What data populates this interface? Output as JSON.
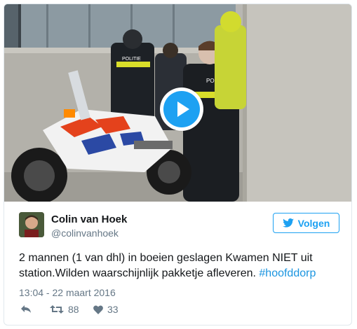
{
  "tweet": {
    "author_name": "Colin van Hoek",
    "author_handle": "@colinvanhoek",
    "follow_label": "Volgen",
    "text_main": "2 mannen (1 van dhl) in boeien geslagen Kwamen NIET uit station.Wilden waarschijnlijk pakketje afleveren. ",
    "hashtag": "#hoofddorp",
    "timestamp": "13:04 - 22 maart 2016",
    "retweets": "88",
    "likes": "33"
  },
  "media": {
    "vest_text": "POLITIE",
    "video_button": "play-icon"
  },
  "colors": {
    "accent": "#1da1f2",
    "hashtag": "#1b95e0",
    "muted": "#657786"
  }
}
